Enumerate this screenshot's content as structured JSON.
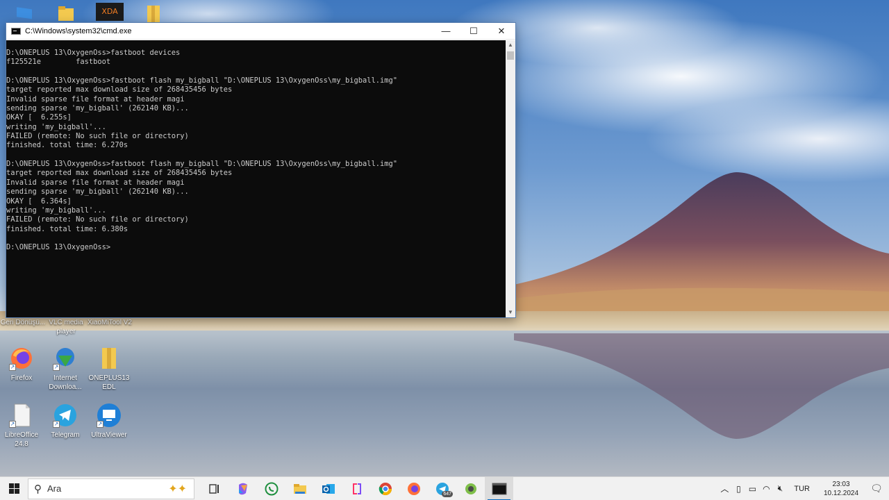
{
  "cmd_window": {
    "title": "C:\\Windows\\system32\\cmd.exe",
    "minimize_glyph": "—",
    "maximize_glyph": "☐",
    "close_glyph": "✕",
    "console_lines": [
      "D:\\ONEPLUS 13\\OxygenOss>fastboot devices",
      "f125521e        fastboot",
      "",
      "D:\\ONEPLUS 13\\OxygenOss>fastboot flash my_bigball \"D:\\ONEPLUS 13\\OxygenOss\\my_bigball.img\"",
      "target reported max download size of 268435456 bytes",
      "Invalid sparse file format at header magi",
      "sending sparse 'my_bigball' (262140 KB)...",
      "OKAY [  6.255s]",
      "writing 'my_bigball'...",
      "FAILED (remote: No such file or directory)",
      "finished. total time: 6.270s",
      "",
      "D:\\ONEPLUS 13\\OxygenOss>fastboot flash my_bigball \"D:\\ONEPLUS 13\\OxygenOss\\my_bigball.img\"",
      "target reported max download size of 268435456 bytes",
      "Invalid sparse file format at header magi",
      "sending sparse 'my_bigball' (262140 KB)...",
      "OKAY [  6.364s]",
      "writing 'my_bigball'...",
      "FAILED (remote: No such file or directory)",
      "finished. total time: 6.380s",
      "",
      "D:\\ONEPLUS 13\\OxygenOss>"
    ]
  },
  "desktop_icons": {
    "row1": [
      {
        "label": "Geri Dönüşü...",
        "icon": "recycle-bin-icon"
      },
      {
        "label": "VLC media player",
        "icon": "vlc-icon"
      },
      {
        "label": "XiaoMiTool V2",
        "icon": "xiaomitool-icon"
      }
    ],
    "row2": [
      {
        "label": "Firefox",
        "icon": "firefox-icon"
      },
      {
        "label": "Internet Downloa...",
        "icon": "idm-icon"
      },
      {
        "label": "ONEPLUS13 EDL",
        "icon": "folder-icon"
      }
    ],
    "row3": [
      {
        "label": "LibreOffice 24.8",
        "icon": "libreoffice-icon"
      },
      {
        "label": "Telegram",
        "icon": "telegram-icon"
      },
      {
        "label": "UltraViewer",
        "icon": "ultraviewer-icon"
      }
    ],
    "top_xda_label": "XDA"
  },
  "taskbar": {
    "search_placeholder": "Ara",
    "apps": [
      {
        "name": "task-view",
        "icon": "task-view-icon"
      },
      {
        "name": "copilot",
        "icon": "copilot-icon"
      },
      {
        "name": "whatsapp",
        "icon": "whatsapp-icon"
      },
      {
        "name": "file-explorer",
        "icon": "folder-icon"
      },
      {
        "name": "outlook",
        "icon": "outlook-icon"
      },
      {
        "name": "jetbrains-toolbox",
        "icon": "toolbox-icon"
      },
      {
        "name": "chrome",
        "icon": "chrome-icon"
      },
      {
        "name": "firefox",
        "icon": "firefox-icon"
      },
      {
        "name": "telegram",
        "icon": "telegram-icon"
      },
      {
        "name": "android-tool",
        "icon": "android-icon"
      },
      {
        "name": "cmd",
        "icon": "terminal-icon"
      }
    ],
    "telegram_badge": "647",
    "tray": {
      "language": "TUR",
      "time": "23:03",
      "date": "10.12.2024"
    }
  },
  "colors": {
    "console_bg": "#0c0c0c",
    "console_fg": "#cccccc",
    "taskbar_bg": "#f1f1f1",
    "accent": "#0067c0"
  }
}
